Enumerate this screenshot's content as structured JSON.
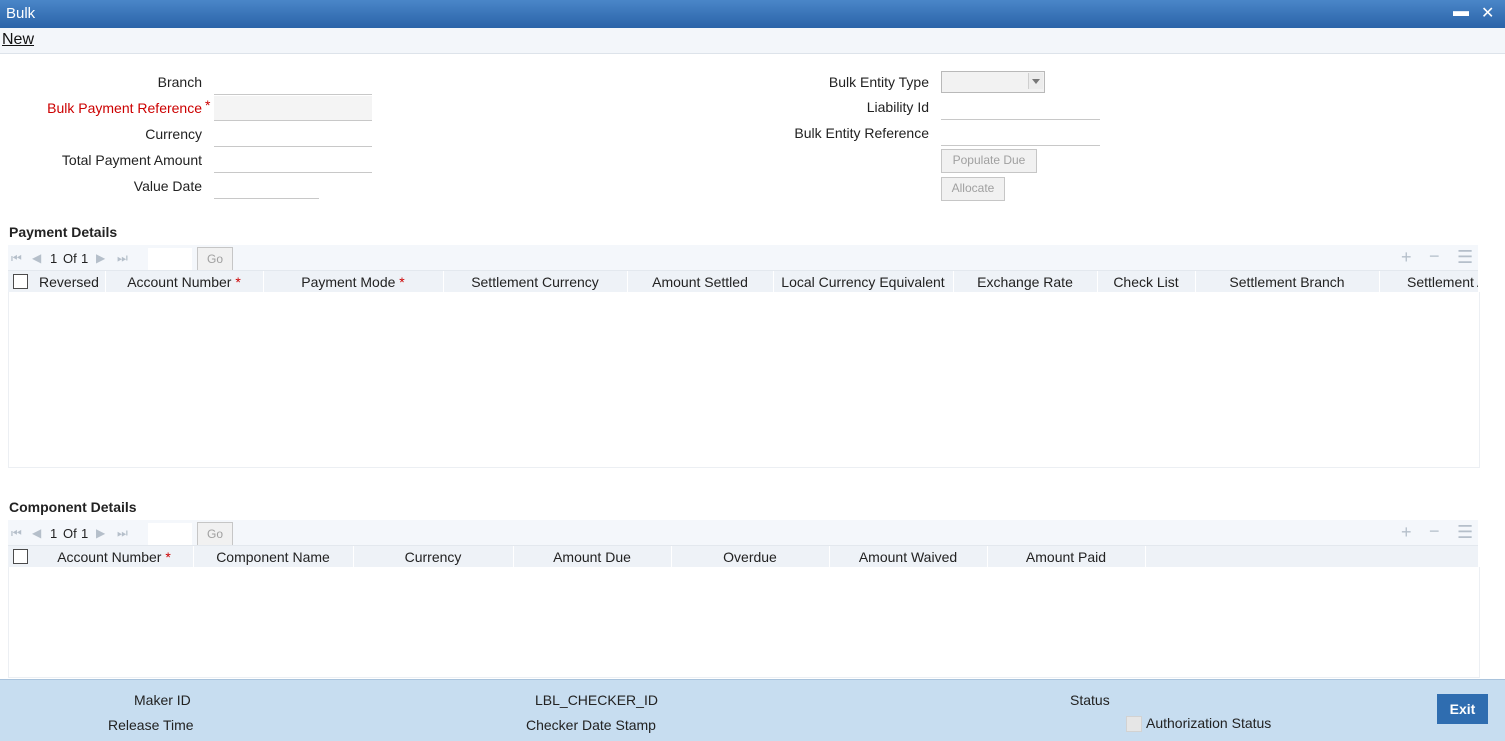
{
  "window": {
    "title": "Bulk",
    "minimize": "▬",
    "close": "✕"
  },
  "menu": {
    "new_label": "New"
  },
  "form_left": {
    "branch_label": "Branch",
    "bulk_payment_reference_label": "Bulk Payment Reference",
    "currency_label": "Currency",
    "total_payment_amount_label": "Total Payment Amount",
    "value_date_label": "Value Date",
    "branch_value": "",
    "bulk_payment_reference_value": "",
    "currency_value": "",
    "total_payment_amount_value": "",
    "value_date_value": ""
  },
  "form_right": {
    "bulk_entity_type_label": "Bulk Entity Type",
    "liability_id_label": "Liability Id",
    "bulk_entity_reference_label": "Bulk Entity Reference",
    "bulk_entity_type_value": "",
    "liability_id_value": "",
    "bulk_entity_reference_value": "",
    "populate_due_label": "Populate Due",
    "allocate_label": "Allocate"
  },
  "required_mark": "*",
  "payment_details": {
    "title": "Payment Details",
    "pager_current": "1",
    "pager_of": "Of",
    "pager_total": "1",
    "go_label": "Go",
    "columns": [
      "Reversed",
      "Account Number",
      "Payment Mode",
      "Settlement Currency",
      "Amount Settled",
      "Local Currency Equivalent",
      "Exchange Rate",
      "Check List",
      "Settlement Branch",
      "Settlement A"
    ]
  },
  "component_details": {
    "title": "Component Details",
    "pager_current": "1",
    "pager_of": "Of",
    "pager_total": "1",
    "go_label": "Go",
    "columns": [
      "Account Number",
      "Component Name",
      "Currency",
      "Amount Due",
      "Overdue",
      "Amount Waived",
      "Amount Paid"
    ]
  },
  "icons": {
    "first": "first-page-icon",
    "prev": "previous-page-icon",
    "next": "next-page-icon",
    "last": "last-page-icon",
    "add": "add-row-icon",
    "delete": "delete-row-icon",
    "view": "single-view-icon"
  },
  "footer": {
    "maker_id_label": "Maker ID",
    "release_time_label": "Release Time",
    "checker_id_label": "LBL_CHECKER_ID",
    "checker_date_stamp_label": "Checker Date Stamp",
    "status_label": "Status",
    "authorization_status_label": "Authorization Status",
    "exit_label": "Exit"
  },
  "colors": {
    "titlebar": "#2a63a8",
    "footer": "#c7ddf0",
    "exit_button": "#2f6db0",
    "required": "#cc0000"
  }
}
